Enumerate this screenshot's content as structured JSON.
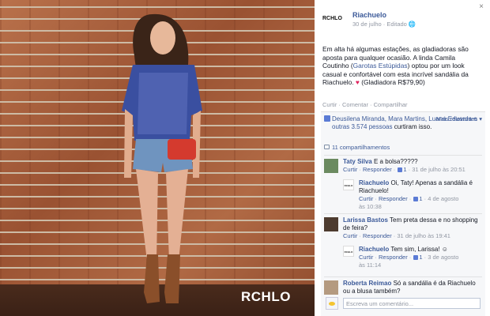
{
  "photo": {
    "brand_logo": "RCHLO"
  },
  "post": {
    "page_name": "Riachuelo",
    "avatar_text": "RCHLO",
    "avatar_sub": "",
    "date": "30 de julho",
    "separator": "·",
    "edited": "Editado",
    "globe_icon": "globe-icon",
    "text_part1": "Em alta há algumas estações, as gladiadoras são aposta para qualquer ocasião. A linda Camila Coutinho (",
    "text_link": "Garotas Estúpidas",
    "text_part2": ") optou por um look casual e confortável com esta incrível sandália da Riachuelo. ",
    "text_part3": " (Gladiadora R$79,90)",
    "close_label": "×"
  },
  "actions": {
    "like": "Curtir",
    "comment": "Comentar",
    "share": "Compartilhar",
    "sep": " · "
  },
  "likes": {
    "text": "Deusilena Miranda, Mara Martins, Luana Eduarda e",
    "others": "outras 3.574 pessoas",
    "suffix": " curtiram isso.",
    "top_comments": "Mais relevantes ▾",
    "shares": "11 compartilhamentos"
  },
  "comments": [
    {
      "name": "Taty Silva",
      "text": " E a bolsa?????",
      "like": "Curtir",
      "reply": "Responder",
      "likes": "1",
      "time": "31 de julho às 20:51"
    },
    {
      "name": "Larissa Bastos",
      "text": " Tem preta dessa e no shopping de feira?",
      "like": "Curtir",
      "reply": "Responder",
      "time": "31 de julho às 19:41"
    },
    {
      "name": "Roberta Reimao",
      "text": " Só a sandália é da Riachuelo ou a blusa também?"
    }
  ],
  "replies": [
    {
      "avatar_text": "RCHLO",
      "name": "Riachuelo",
      "text": " Oi, Taty! Apenas a sandália é Riachuelo!",
      "like": "Curtir",
      "reply": "Responder",
      "likes": "1",
      "time_line1": "4 de agosto",
      "time_line2": "às 10:38"
    },
    {
      "avatar_text": "RCHLO",
      "name": "Riachuelo",
      "text": " Tem sim, Larissa! ",
      "emoji": "☺",
      "like": "Curtir",
      "reply": "Responder",
      "likes": "1",
      "time_line1": "3 de agosto",
      "time_line2": "às 11:14"
    }
  ],
  "comment_box": {
    "placeholder": "Escreva um comentário..."
  },
  "colors": {
    "link": "#3b5998",
    "muted": "#9197a3",
    "ufi_bg": "#f6f7f9"
  }
}
